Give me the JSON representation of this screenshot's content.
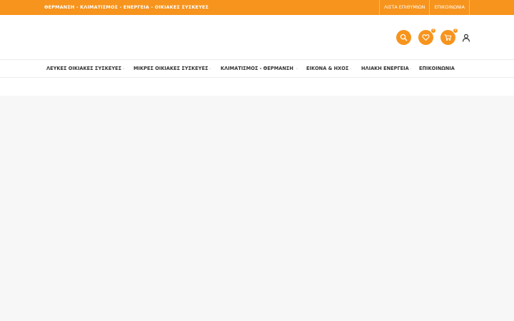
{
  "topbar": {
    "promo": "ΘΕΡΜΑΝΣΗ - ΚΛΙΜΑΤΙΣΜΟΣ - ΕΝΕΡΓΕΙΑ - ΟΙΚΙΑΚΕΣ ΣΥΣΚΕΥΕΣ",
    "links": [
      "ΛΙΣΤΑ ΕΠΙΘΥΜΙΩΝ",
      "ΕΠΙΚΟΙΝΩΝΙΑ"
    ]
  },
  "header": {
    "icons": {
      "search": "search-icon",
      "wishlist": "heart-icon",
      "cart": "cart-icon",
      "account": "user-icon"
    },
    "wishlist_count": "0",
    "cart_count": "0"
  },
  "nav": {
    "items": [
      {
        "label": "ΛΕΥΚΕΣ ΟΙΚΙΑΚΕΣ ΣΥΣΚΕΥΕΣ",
        "dropdown": true
      },
      {
        "label": "ΜΙΚΡΕΣ ΟΙΚΙΑΚΕΣ ΣΥΣΚΕΥΕΣ",
        "dropdown": true
      },
      {
        "label": "ΚΛΙΜΑΤΙΣΜΟΣ - ΘΕΡΜΑΝΣΗ",
        "dropdown": true
      },
      {
        "label": "ΕΙΚΟΝΑ & ΗΧΟΣ",
        "dropdown": true
      },
      {
        "label": "ΗΛΙΑΚΗ ΕΝΕΡΓΕΙΑ",
        "dropdown": true
      },
      {
        "label": "ΕΠΙΚΟΙΝΩΝΙΑ",
        "dropdown": false
      }
    ]
  },
  "colors": {
    "accent": "#f7941d",
    "nav_text": "#333333",
    "page_bg": "#f7f7f7"
  }
}
